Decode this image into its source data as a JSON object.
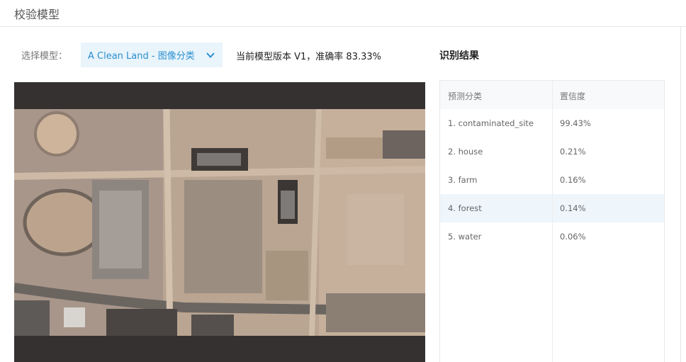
{
  "header": {
    "title": "校验模型"
  },
  "model_selector": {
    "label": "选择模型：",
    "value": "A Clean Land - 图像分类"
  },
  "version_info": "当前模型版本 V1，准确率 83.33%",
  "results": {
    "title": "识别结果",
    "columns": [
      "预测分类",
      "置信度"
    ],
    "rows": [
      {
        "label": "1. contaminated_site",
        "confidence": "99.43%"
      },
      {
        "label": "2. house",
        "confidence": "0.21%"
      },
      {
        "label": "3. farm",
        "confidence": "0.16%"
      },
      {
        "label": "4. forest",
        "confidence": "0.14%"
      },
      {
        "label": "5. water",
        "confidence": "0.06%"
      }
    ],
    "highlighted_row": 3
  },
  "colors": {
    "accent": "#2a8fd0",
    "select_bg": "#e9f4fb",
    "highlight_row": "#eef6fc",
    "image_frame": "#363131"
  }
}
